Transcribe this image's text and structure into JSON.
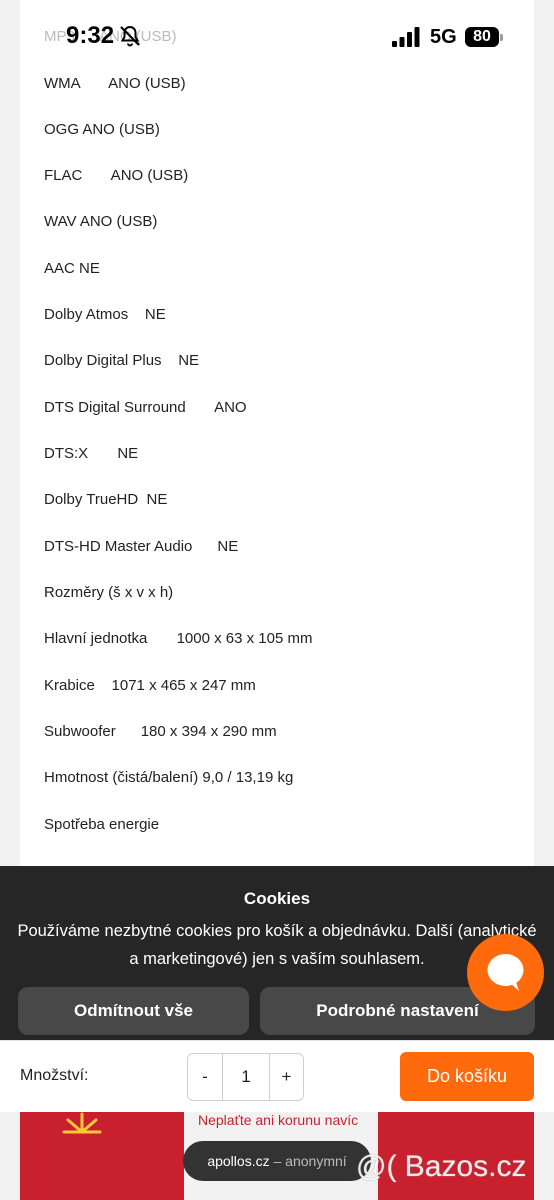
{
  "status_bar": {
    "time": "9:32",
    "network": "5G",
    "battery": "80"
  },
  "specs": [
    {
      "text": "MP3      ANO (USB)",
      "faded": true
    },
    {
      "text": "WMA       ANO (USB)"
    },
    {
      "text": "OGG ANO (USB)"
    },
    {
      "text": "FLAC       ANO (USB)"
    },
    {
      "text": "WAV ANO (USB)"
    },
    {
      "text": "AAC NE"
    },
    {
      "text": "Dolby Atmos    NE"
    },
    {
      "text": "Dolby Digital Plus    NE"
    },
    {
      "text": "DTS Digital Surround       ANO"
    },
    {
      "text": "DTS:X       NE"
    },
    {
      "text": "Dolby TrueHD  NE"
    },
    {
      "text": "DTS-HD Master Audio      NE"
    },
    {
      "text": "Rozměry (š x v x h)"
    },
    {
      "text": "Hlavní jednotka       1000 x 63 x 105 mm"
    },
    {
      "text": "Krabice    1071 x 465 x 247 mm"
    },
    {
      "text": "Subwoofer      180 x 394 x 290 mm"
    },
    {
      "text": "Hmotnost (čistá/balení) 9,0 / 13,19 kg"
    },
    {
      "text": "Spotřeba energie"
    }
  ],
  "cookies": {
    "title": "Cookies",
    "text": "Používáme nezbytné cookies pro košík a objednávku. Další (analytické a marketingové) jen s vaším souhlasem.",
    "reject_label": "Odmítnout vše",
    "settings_label": "Podrobné nastavení"
  },
  "cart": {
    "qty_label": "Množství:",
    "minus": "-",
    "qty_value": "1",
    "plus": "+",
    "add_label": "Do košíku"
  },
  "promo": {
    "text": "Neplaťte ani korunu navíc"
  },
  "browser": {
    "domain": "apollos.cz",
    "separator": "–",
    "mode": "anonymní"
  },
  "watermark": "@( Bazos.cz",
  "colors": {
    "accent": "#ff6a0d",
    "banner": "#262626",
    "promo_red": "#c8202e"
  }
}
